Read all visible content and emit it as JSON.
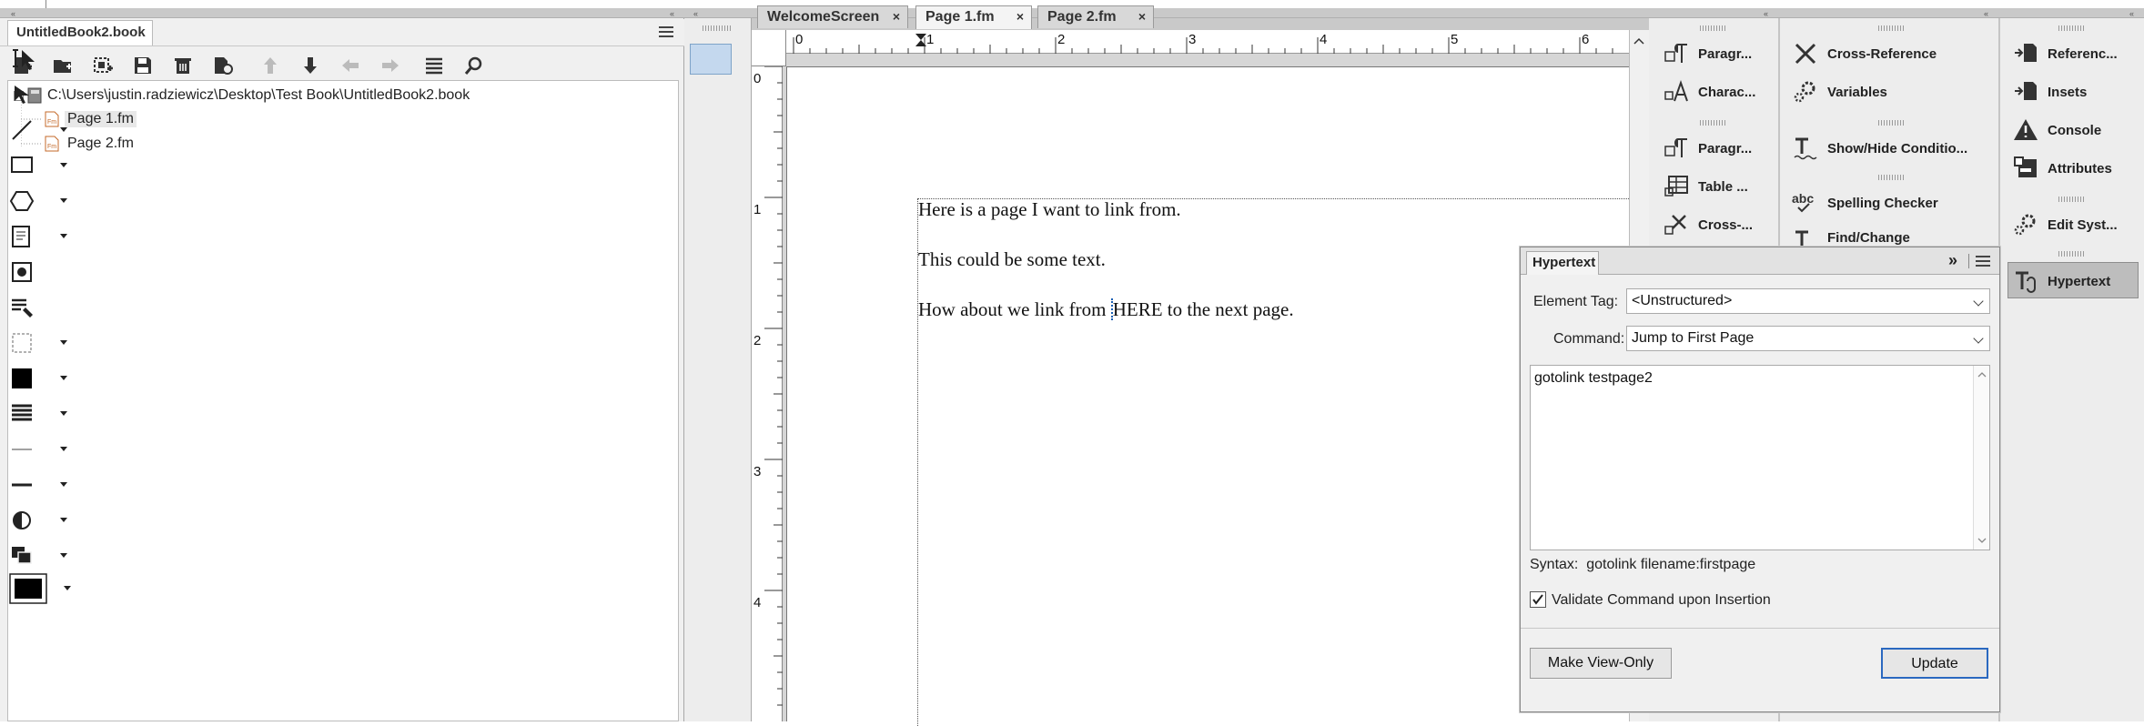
{
  "book": {
    "tab_title": "UntitledBook2.book",
    "collapse_glyph": "«",
    "toolbar_icons": [
      "add-file-icon",
      "add-folder-icon",
      "add-group-icon",
      "save-icon",
      "delete-icon",
      "update-book-icon",
      "move-up-icon",
      "move-down-icon",
      "back-icon",
      "forward-icon",
      "list-icon",
      "search-icon"
    ],
    "tree": {
      "root_label": "C:\\Users\\justin.radziewicz\\Desktop\\Test Book\\UntitledBook2.book",
      "items": [
        {
          "label": "Page 1.fm",
          "selected": true
        },
        {
          "label": "Page 2.fm",
          "selected": false
        }
      ]
    }
  },
  "doc_tabs": [
    {
      "label": "WelcomeScreen",
      "close": "×",
      "active": false
    },
    {
      "label": "Page 1.fm",
      "close": "×",
      "active": true
    },
    {
      "label": "Page 2.fm",
      "close": "×",
      "active": false
    }
  ],
  "ruler": {
    "h_labels": [
      "0",
      "1",
      "2",
      "3",
      "4",
      "5",
      "6"
    ],
    "v_labels": [
      "0",
      "1",
      "2",
      "3",
      "4"
    ]
  },
  "page_text": {
    "line1": "Here is a page I want to link from.",
    "line2": "This could be some text.",
    "line3_before": "How about we link from ",
    "line3_link": "HERE",
    "line3_after": " to the next page."
  },
  "pods": {
    "col1": [
      "Paragr...",
      "Charac...",
      "Paragr...",
      "Table ...",
      "Cross-..."
    ],
    "col2": [
      "Cross-Reference",
      "Variables",
      "Show/Hide Conditio...",
      "Spelling Checker",
      "Find/Change"
    ],
    "col3": [
      "Referenc...",
      "Insets",
      "Console",
      "Attributes",
      "Edit Syst...",
      "Hypertext"
    ]
  },
  "hypertext": {
    "tab": "Hypertext",
    "expand_glyph": "»",
    "element_tag_label": "Element Tag:",
    "element_tag_value": "<Unstructured>",
    "command_label": "Command:",
    "command_value": "Jump to First Page",
    "command_text": "gotolink testpage2",
    "syntax_label": "Syntax:",
    "syntax_value": "gotolink filename:firstpage",
    "validate_label": "Validate Command upon Insertion",
    "validate_checked": true,
    "make_view_only_label": "Make View-Only",
    "update_label": "Update"
  }
}
